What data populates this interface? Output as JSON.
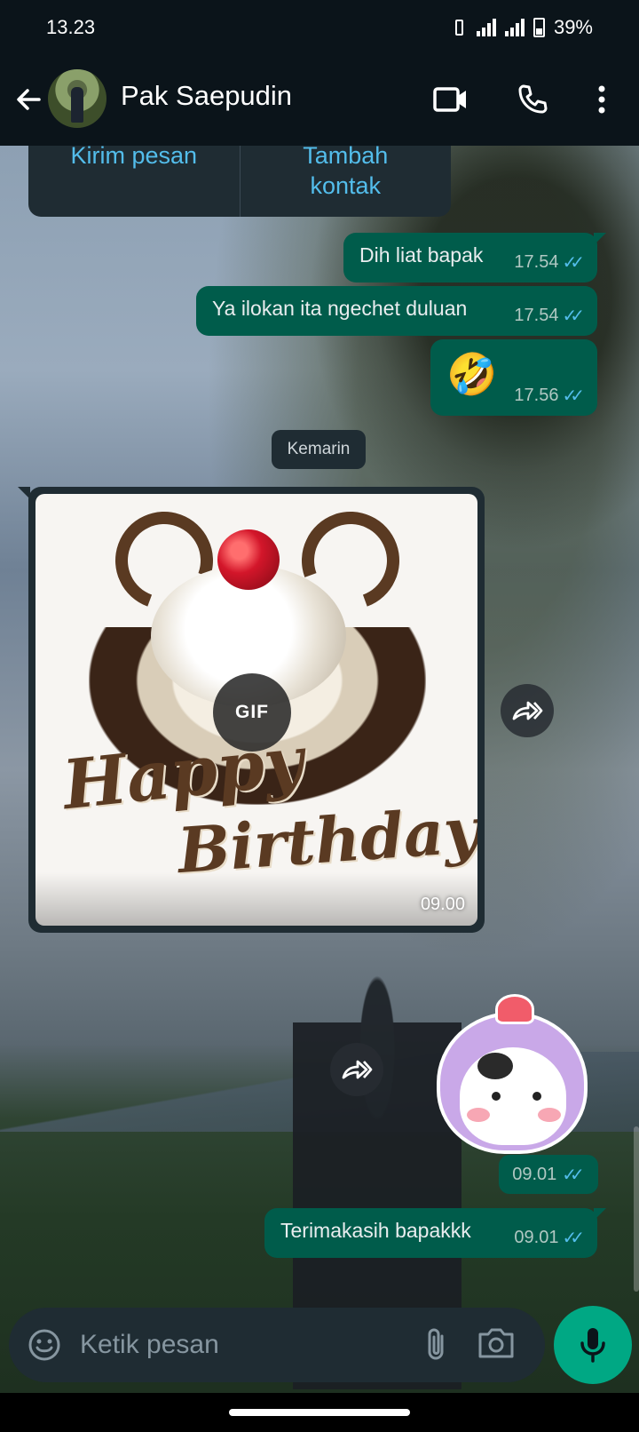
{
  "status_bar": {
    "time": "13.23",
    "battery": "39%"
  },
  "header": {
    "contact_name": "Pak Saepudin"
  },
  "info_card": {
    "send_message": "Kirim pesan",
    "add_contact": "Tambah kontak"
  },
  "messages": [
    {
      "text": "Dih liat bapak",
      "time": "17.54"
    },
    {
      "text": "Ya ilokan ita ngechet duluan",
      "time": "17.54"
    },
    {
      "text": "🤣",
      "time": "17.56"
    }
  ],
  "date_divider": "Kemarin",
  "gif_message": {
    "badge": "GIF",
    "time": "09.00",
    "line1": "Happy",
    "line2": "Birthday!"
  },
  "sticker_message": {
    "time": "09.01"
  },
  "last_message": {
    "text": "Terimakasih bapakkk",
    "time": "09.01"
  },
  "composer": {
    "placeholder": "Ketik pesan"
  },
  "icons": {
    "back": "arrow-left-icon",
    "video": "video-camera-icon",
    "call": "phone-icon",
    "menu": "more-vertical-icon",
    "emoji": "emoji-icon",
    "attach": "paperclip-icon",
    "camera": "camera-icon",
    "mic": "microphone-icon",
    "forward": "forward-icon"
  },
  "colors": {
    "accent": "#00a884",
    "outgoing_bubble": "#005c4b",
    "link": "#53bdeb",
    "read_ticks": "#53bdeb"
  }
}
